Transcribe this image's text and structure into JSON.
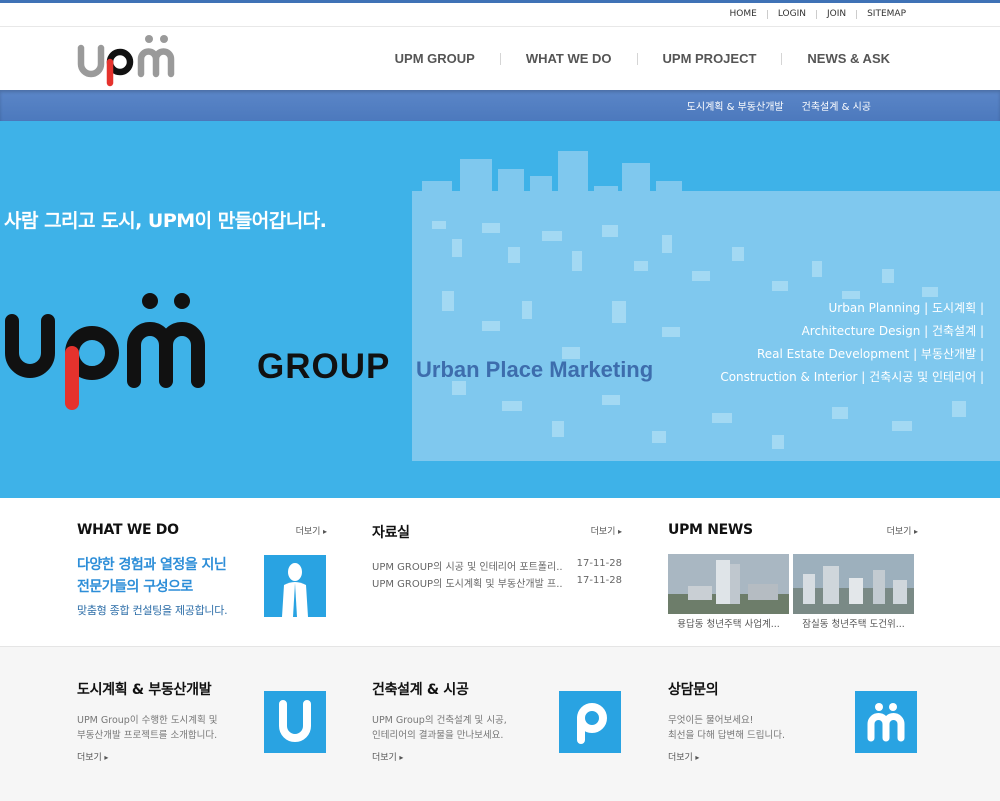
{
  "util_nav": [
    "HOME",
    "LOGIN",
    "JOIN",
    "SITEMAP"
  ],
  "gnb": [
    "UPM GROUP",
    "WHAT WE DO",
    "UPM PROJECT",
    "NEWS & ASK"
  ],
  "subnav": [
    "도시계획 & 부동산개발",
    "건축설계 & 시공"
  ],
  "hero": {
    "slogan": "사람 그리고 도시, UPM이 만들어갑니다.",
    "group": "GROUP",
    "tagline": "Urban Place Marketing",
    "services": [
      "Urban Planning | 도시계획 |",
      "Architecture Design | 건축설계 |",
      "Real Estate Development | 부동산개발 |",
      "Construction & Interior | 건축시공 및 인테리어 |"
    ]
  },
  "whatwedo": {
    "title": "WHAT WE DO",
    "more": "더보기",
    "lead1": "다양한 경험과 열정을 지닌",
    "lead2": "전문가들의 구성으로",
    "sub": "맞춤형 종합 컨설팅을 제공합니다."
  },
  "pds": {
    "title": "자료실",
    "more": "더보기",
    "items": [
      {
        "title": "UPM GROUP의 시공 및 인테리어 포트폴리..",
        "date": "17-11-28"
      },
      {
        "title": "UPM GROUP의 도시계획 및 부동산개발 프..",
        "date": "17-11-28"
      }
    ]
  },
  "news": {
    "title": "UPM NEWS",
    "more": "더보기",
    "items": [
      {
        "caption": "용답동 청년주택 사업계..."
      },
      {
        "caption": "잠실동 청년주택 도건위..."
      }
    ]
  },
  "services_row": [
    {
      "title": "도시계획 & 부동산개발",
      "desc1": "UPM Group이 수행한 도시계획 및",
      "desc2": "부동산개발 프로젝트를 소개합니다.",
      "more": "더보기",
      "letter": "U"
    },
    {
      "title": "건축설계 & 시공",
      "desc1": "UPM Group의 건축설계 및 시공,",
      "desc2": "인테리어의 결과물을 만나보세요.",
      "more": "더보기",
      "letter": "P"
    },
    {
      "title": "상담문의",
      "desc1": "무엇이든 물어보세요!",
      "desc2": "최선을 다해 답변해 드립니다.",
      "more": "더보기",
      "letter": "M"
    }
  ],
  "colors": {
    "accent": "#29a3e2",
    "hero_bg": "#3eb2e8",
    "subbar": "#4c79bd",
    "logo_red": "#e5322d"
  }
}
